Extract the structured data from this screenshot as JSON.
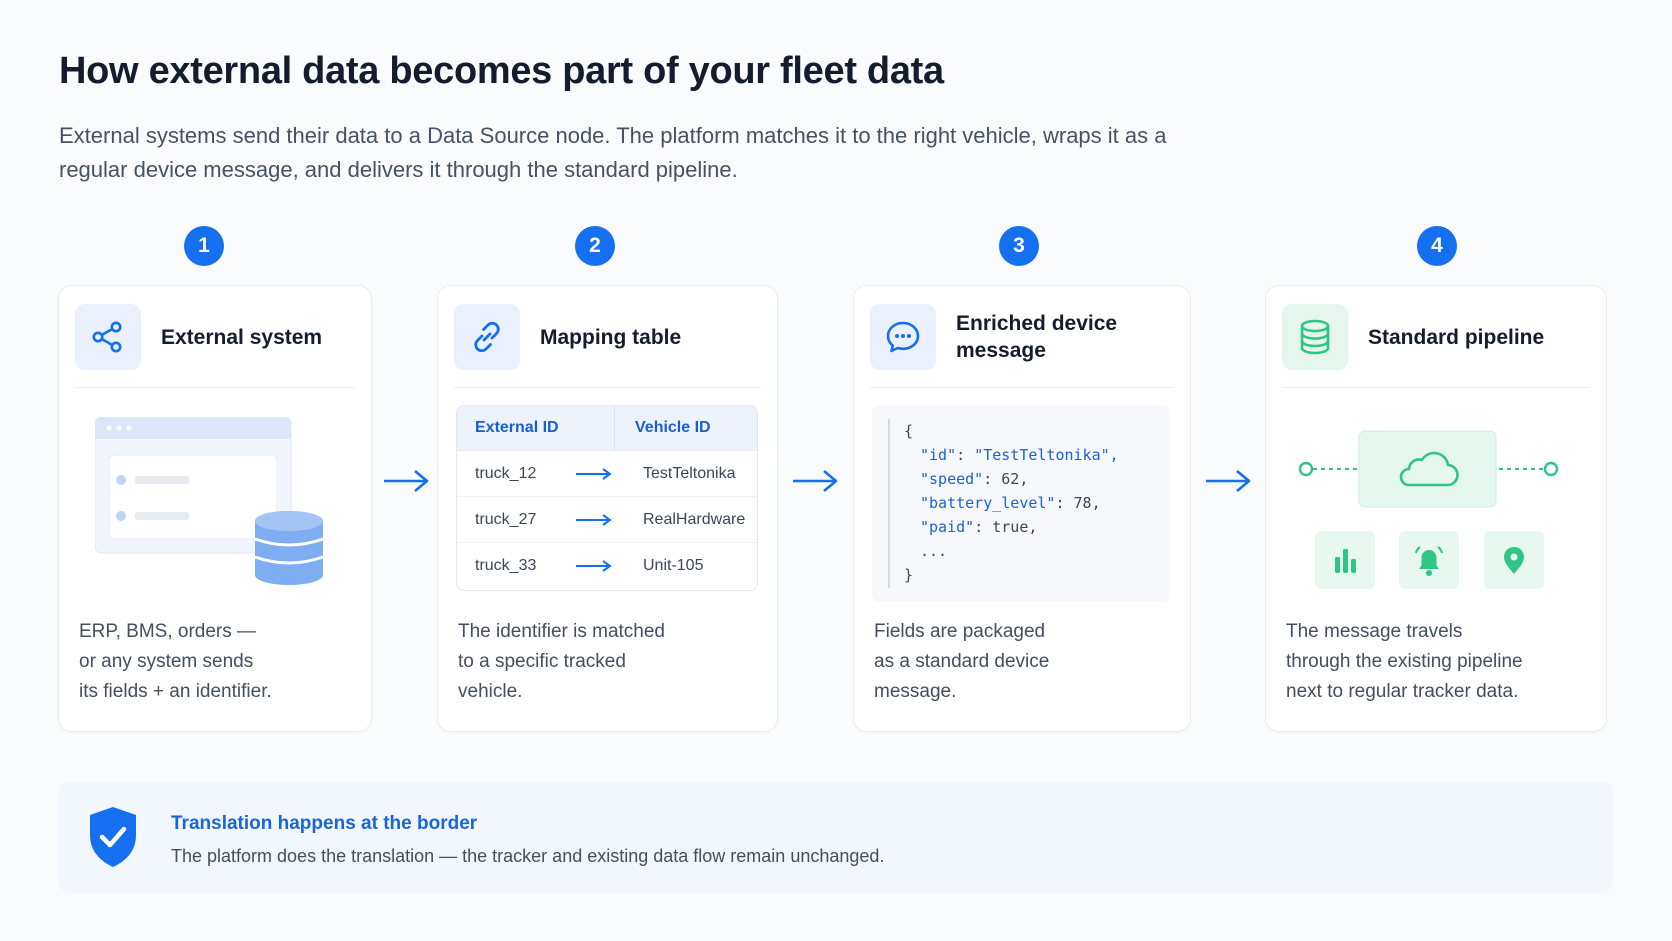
{
  "header": {
    "title": "How external data becomes part of your fleet data",
    "subtitle": "External systems send their data to a Data Source node. The platform matches it to the right vehicle, wraps it as a regular device message, and delivers it through the standard pipeline."
  },
  "steps": [
    {
      "number": "1",
      "title": "External system",
      "icon": "share-nodes-icon",
      "description": "ERP, BMS, orders —\nor any system sends\nits fields + an identifier."
    },
    {
      "number": "2",
      "title": "Mapping table",
      "icon": "link-icon",
      "description": "The identifier is matched\nto a specific tracked\nvehicle.",
      "table": {
        "headers": [
          "External ID",
          "Vehicle ID"
        ],
        "rows": [
          {
            "external_id": "truck_12",
            "vehicle_id": "TestTeltonika"
          },
          {
            "external_id": "truck_27",
            "vehicle_id": "RealHardware"
          },
          {
            "external_id": "truck_33",
            "vehicle_id": "Unit-105"
          }
        ]
      }
    },
    {
      "number": "3",
      "title": "Enriched device message",
      "icon": "chat-bubble-icon",
      "description": "Fields are packaged\nas a standard device\nmessage.",
      "code": {
        "open": "{",
        "lines": [
          {
            "key": "\"id\"",
            "value": "\"TestTeltonika\","
          },
          {
            "key": "\"speed\"",
            "value": "62,"
          },
          {
            "key": "\"battery_level\"",
            "value": "78,"
          },
          {
            "key": "\"paid\"",
            "value": "true,"
          }
        ],
        "ellipsis": "...",
        "close": "}"
      }
    },
    {
      "number": "4",
      "title": "Standard pipeline",
      "icon": "database-icon",
      "description": "The message travels\nthrough the existing pipeline\nnext to regular tracker data."
    }
  ],
  "banner": {
    "title": "Translation happens at the border",
    "text": "The platform does the translation — the tracker and existing data flow remain unchanged."
  },
  "colors": {
    "primary_blue": "#1570ef",
    "accent_green": "#2fc584",
    "text_dark": "#141c2e"
  }
}
